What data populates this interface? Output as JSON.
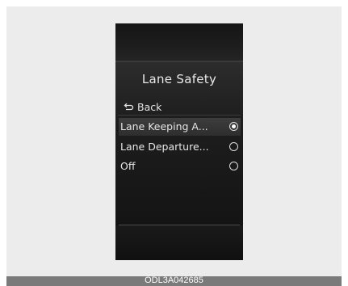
{
  "menu": {
    "title": "Lane Safety",
    "back_label": "Back",
    "options": [
      {
        "label": "Lane Keeping A...",
        "selected": true
      },
      {
        "label": "Lane Departure...",
        "selected": false
      },
      {
        "label": "Off",
        "selected": false
      }
    ]
  },
  "figure": {
    "code": "ODL3A042685"
  },
  "icons": {
    "back": "return-arrow-icon",
    "radio_selected": "radio-selected-icon",
    "radio_unselected": "radio-unselected-icon"
  },
  "colors": {
    "screen_bg": "#111111",
    "text": "#e6e6e6",
    "selected_row": "#3d3d3d",
    "caption_bar": "#7a7a7a"
  }
}
